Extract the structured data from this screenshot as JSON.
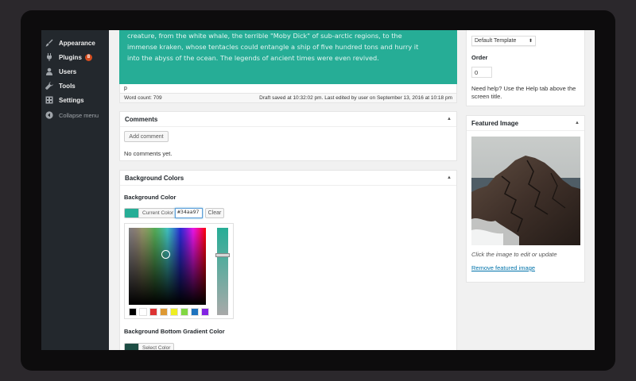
{
  "sidebar": {
    "items": [
      {
        "label": "Appearance",
        "icon": "paintbrush-icon"
      },
      {
        "label": "Plugins",
        "icon": "plugins-icon",
        "badge": "8"
      },
      {
        "label": "Users",
        "icon": "users-icon"
      },
      {
        "label": "Tools",
        "icon": "wrench-icon"
      },
      {
        "label": "Settings",
        "icon": "settings-icon"
      }
    ],
    "collapse_label": "Collapse menu"
  },
  "editor": {
    "content": "creature, from the white whale, the terrible \"Moby Dick\" of sub-arctic regions, to the\nimmense kraken, whose tentacles could entangle a ship of five hundred tons and hurry it\ninto the abyss of the ocean. The legends of ancient times were even revived.",
    "path": "p",
    "word_count": "Word count: 709",
    "draft_status": "Draft saved at 10:32:02 pm. Last edited by user on September 13, 2016 at 10:18 pm",
    "text_bg_color": "#26ad96"
  },
  "comments": {
    "title": "Comments",
    "add_button": "Add comment",
    "empty_text": "No comments yet."
  },
  "background_colors": {
    "title": "Background Colors",
    "bg_color_label": "Background Color",
    "current_color_label": "Current Color",
    "current_color": "#26ad96",
    "hex_value": "#34aa97",
    "clear_label": "Clear",
    "palette": [
      "#000000",
      "#ffffff",
      "#dd3333",
      "#dd9933",
      "#eeee22",
      "#81d742",
      "#1e73be",
      "#8224e3"
    ],
    "bottom_gradient_label": "Background Bottom Gradient Color",
    "select_color_label": "Select Color",
    "bottom_color": "#1d4d44"
  },
  "page_attributes": {
    "template_value": "Default Template",
    "order_label": "Order",
    "order_value": "0",
    "help_text_1": "Need help? Use the Help tab above the",
    "help_text_2": "screen title."
  },
  "featured_image": {
    "title": "Featured Image",
    "hint": "Click the image to edit or update",
    "remove_link": "Remove featured image"
  }
}
